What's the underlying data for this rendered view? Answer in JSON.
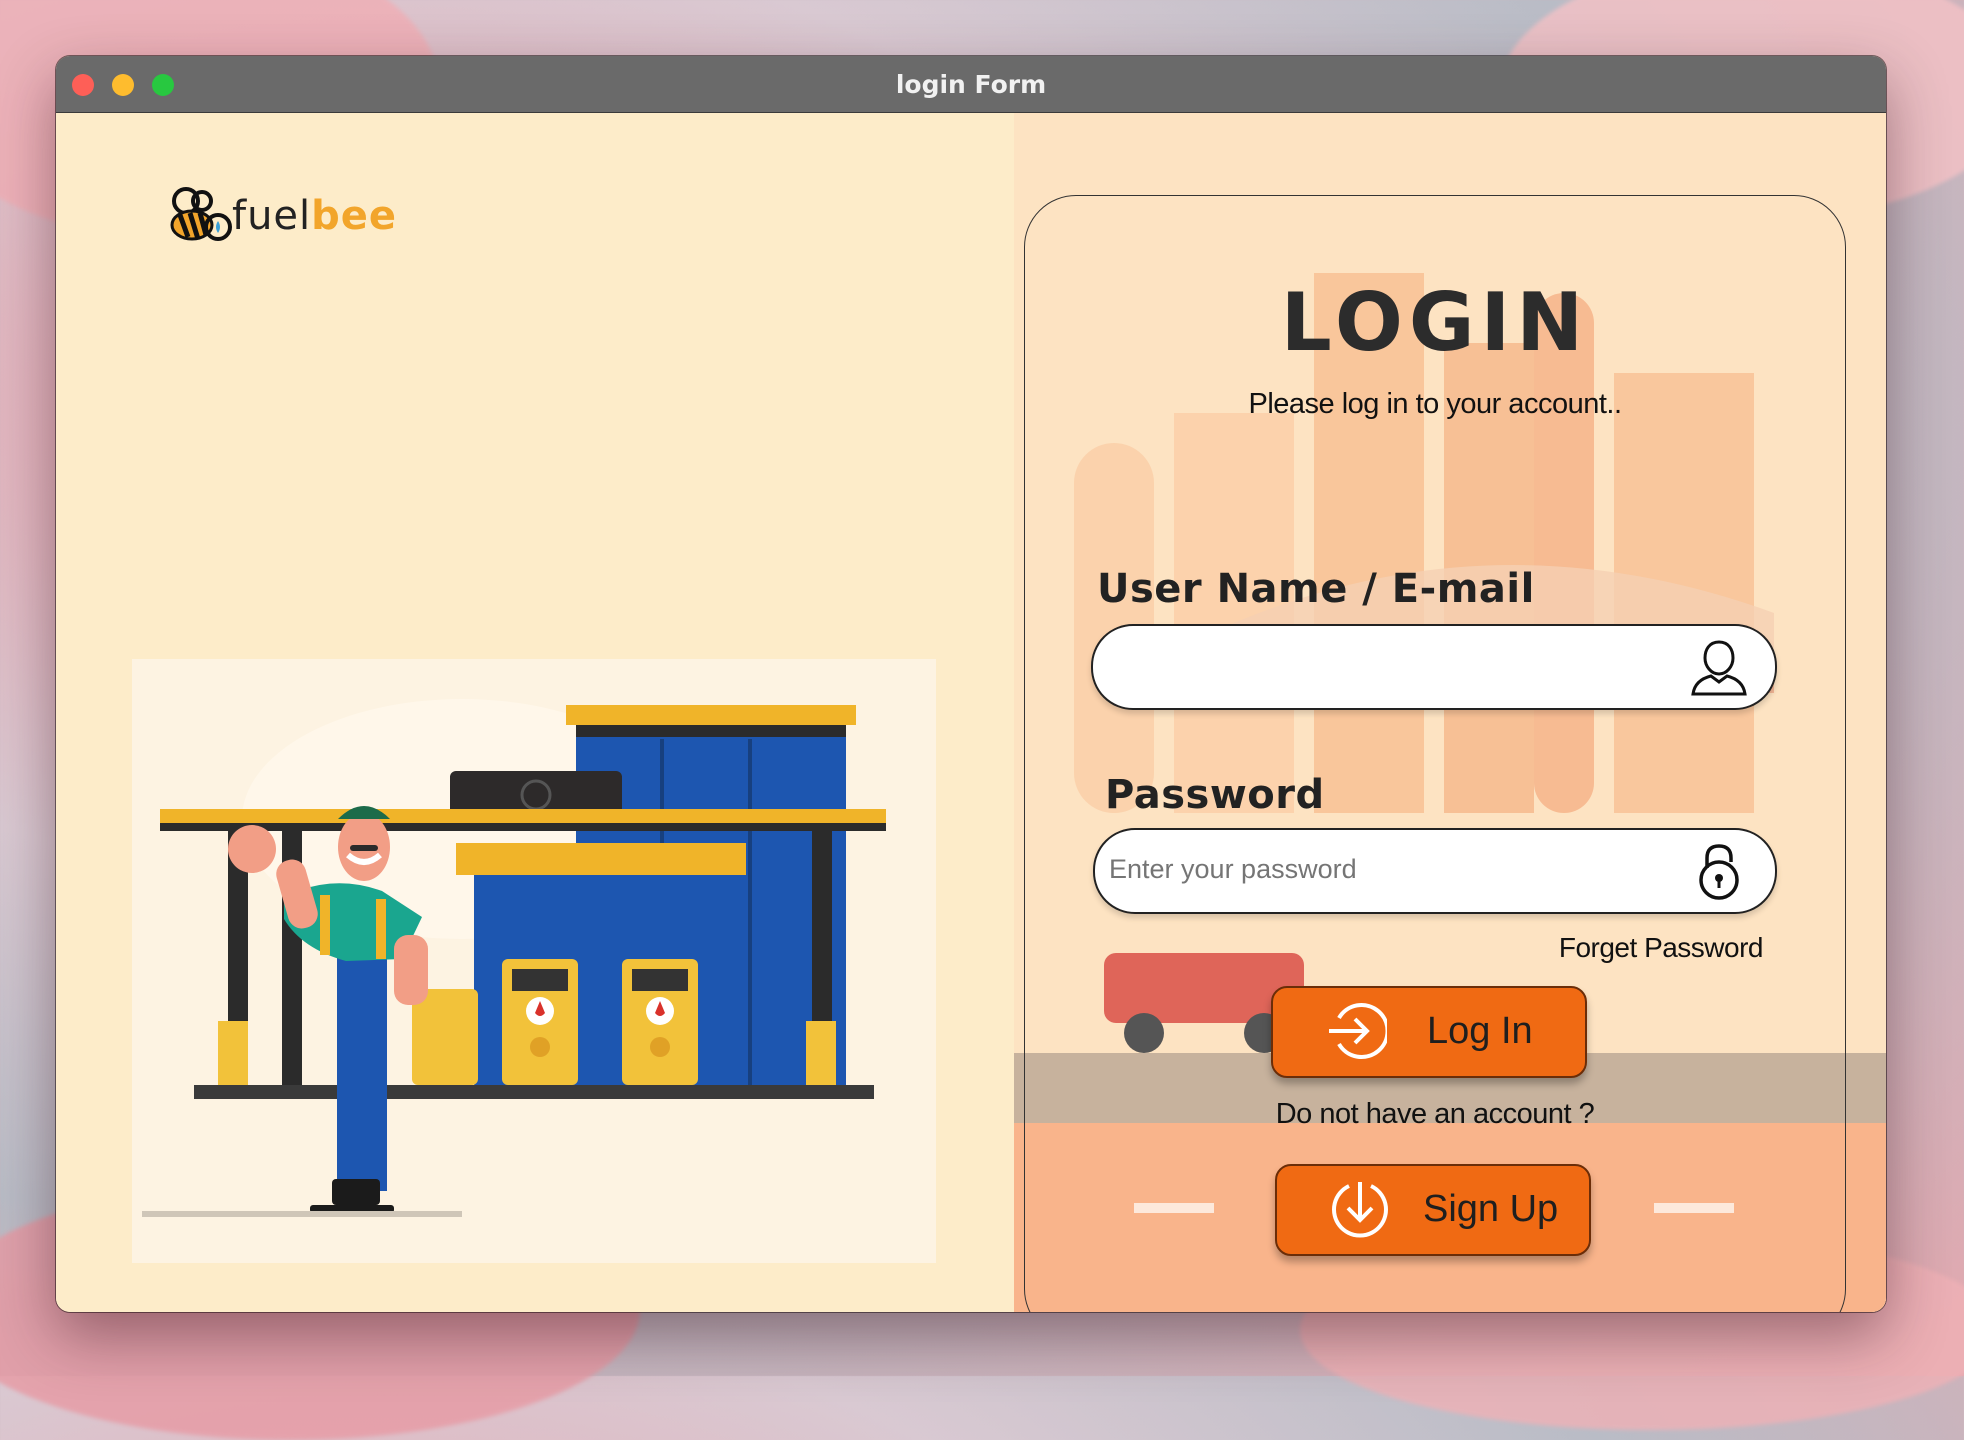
{
  "window": {
    "title": "login Form"
  },
  "brand": {
    "part1": "fuel",
    "part2": "bee"
  },
  "login": {
    "title": "LOGIN",
    "subtitle": "Please log in to your account..",
    "username_label": "User Name / E-mail",
    "username_value": "",
    "password_label": "Password",
    "password_placeholder": "Enter your password",
    "forget_password": "Forget Password",
    "login_button": "Log In",
    "no_account_text": "Do not have an account ?",
    "signup_button": "Sign Up"
  },
  "icons": {
    "user_field": "user-icon",
    "password_field": "lock-icon",
    "login_button": "login-arrow-icon",
    "signup_button": "download-arrow-icon"
  },
  "colors": {
    "accent": "#f06a13",
    "brand": "#f2a52b",
    "left_bg": "#fdecc9",
    "right_bg": "#fbd9b3"
  }
}
